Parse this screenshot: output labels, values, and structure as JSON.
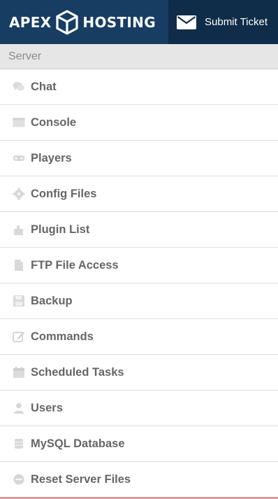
{
  "header": {
    "brand_left": "APEX",
    "brand_right": "HOSTING",
    "submit_ticket": "Submit Ticket",
    "bg_color": "#173d63",
    "ticket_bg_color": "#0f2c49"
  },
  "sidebar": {
    "section_title": "Server",
    "items": [
      {
        "label": "Chat",
        "icon": "chat-icon"
      },
      {
        "label": "Console",
        "icon": "console-icon"
      },
      {
        "label": "Players",
        "icon": "players-icon"
      },
      {
        "label": "Config Files",
        "icon": "gear-icon"
      },
      {
        "label": "Plugin List",
        "icon": "puzzle-icon"
      },
      {
        "label": "FTP File Access",
        "icon": "file-icon"
      },
      {
        "label": "Backup",
        "icon": "save-icon"
      },
      {
        "label": "Commands",
        "icon": "edit-icon"
      },
      {
        "label": "Scheduled Tasks",
        "icon": "calendar-icon"
      },
      {
        "label": "Users",
        "icon": "user-icon"
      },
      {
        "label": "MySQL Database",
        "icon": "database-icon"
      },
      {
        "label": "Reset Server Files",
        "icon": "reset-icon"
      }
    ]
  }
}
